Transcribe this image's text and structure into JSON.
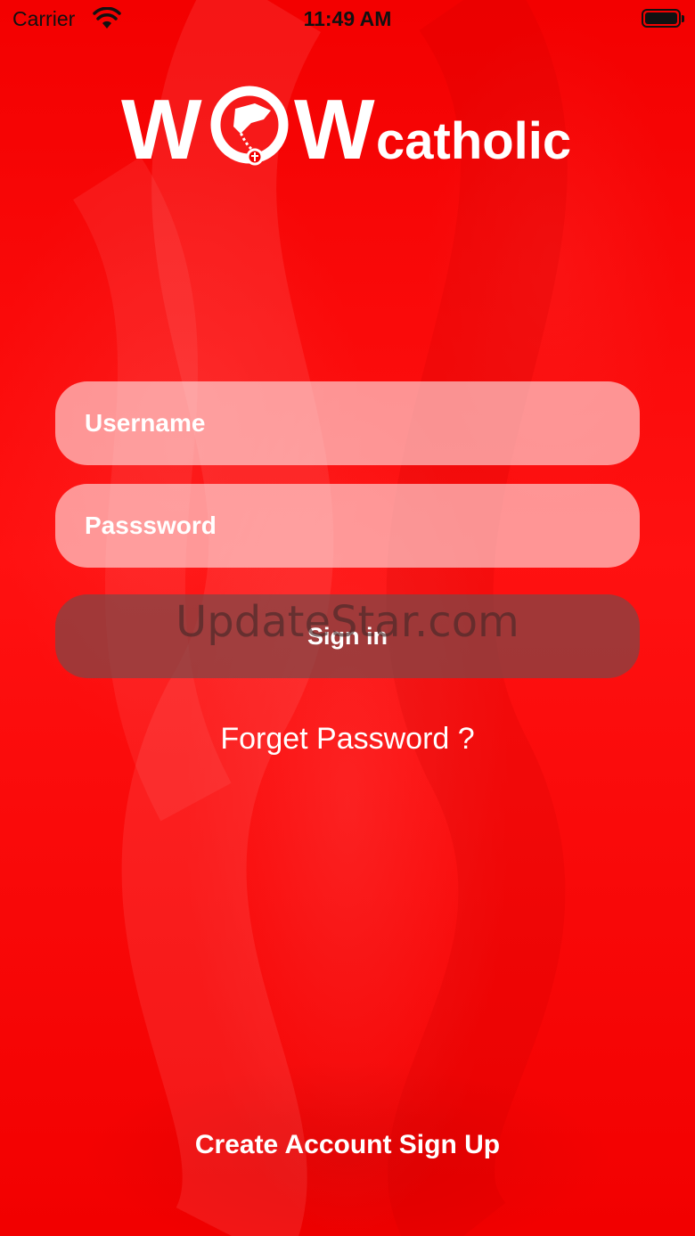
{
  "status_bar": {
    "carrier": "Carrier",
    "time": "11:49 AM",
    "wifi_icon": "wifi-icon",
    "battery_icon": "battery-icon"
  },
  "logo": {
    "text_wow_w1": "W",
    "text_wow_w2": "W",
    "text_catholic": "catholic",
    "icon": "praying-hands-rosary-icon"
  },
  "form": {
    "username_placeholder": "Username",
    "username_value": "",
    "password_placeholder": "Passsword",
    "password_value": "",
    "signin_label": "Sign in",
    "forgot_label": "Forget Password ?"
  },
  "footer": {
    "create_account_label": "Create Account Sign Up"
  },
  "watermark": "UpdateStar.com",
  "colors": {
    "background": "#f40000",
    "field_background": "rgba(255,230,230,0.62)",
    "button_background": "rgba(125,70,70,0.72)",
    "text": "#ffffff"
  }
}
